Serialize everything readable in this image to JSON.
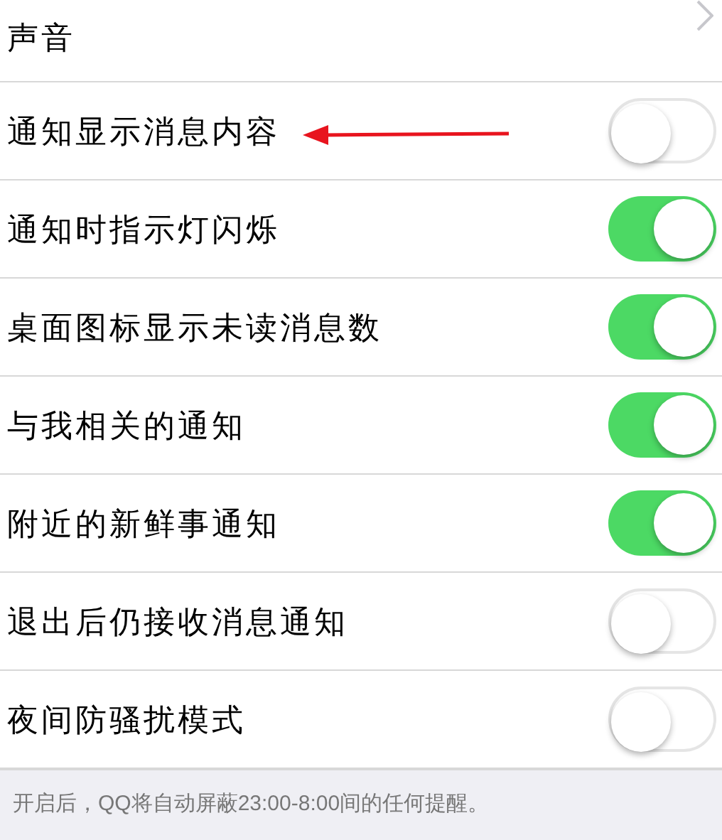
{
  "rows": [
    {
      "kind": "link",
      "label": "声音",
      "annotated": false
    },
    {
      "kind": "toggle",
      "label": "通知显示消息内容",
      "on": false,
      "annotated": true
    },
    {
      "kind": "toggle",
      "label": "通知时指示灯闪烁",
      "on": true,
      "annotated": false
    },
    {
      "kind": "toggle",
      "label": "桌面图标显示未读消息数",
      "on": true,
      "annotated": false
    },
    {
      "kind": "toggle",
      "label": "与我相关的通知",
      "on": true,
      "annotated": false
    },
    {
      "kind": "toggle",
      "label": "附近的新鲜事通知",
      "on": true,
      "annotated": false
    },
    {
      "kind": "toggle",
      "label": "退出后仍接收消息通知",
      "on": false,
      "annotated": false
    },
    {
      "kind": "toggle",
      "label": "夜间防骚扰模式",
      "on": false,
      "annotated": false
    }
  ],
  "footer": "开启后，QQ将自动屏蔽23:00-8:00间的任何提醒。"
}
